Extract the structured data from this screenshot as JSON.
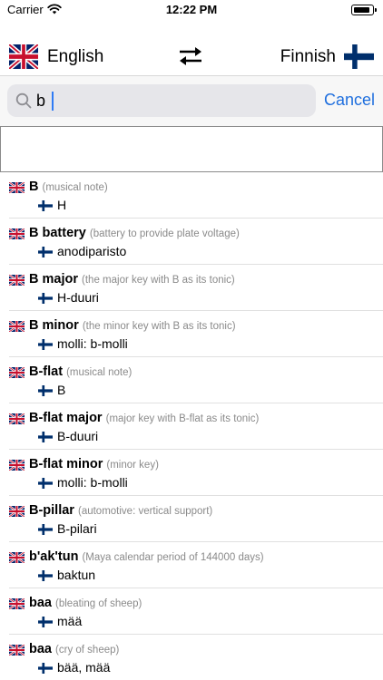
{
  "status_bar": {
    "carrier": "Carrier",
    "time": "12:22 PM"
  },
  "languages": {
    "source": "English",
    "target": "Finnish",
    "source_flag": "uk-flag-icon",
    "target_flag": "finland-flag-icon"
  },
  "search": {
    "value": "b",
    "cancel_label": "Cancel"
  },
  "colors": {
    "accent": "#1f6fde",
    "note": "#8a8a8a",
    "flag_uk_blue": "#012169",
    "flag_uk_red": "#C8102E",
    "flag_fi_blue": "#002F6C"
  },
  "entries": [
    {
      "term": "B",
      "note": "(musical note)",
      "translation": "H"
    },
    {
      "term": "B battery",
      "note": "(battery to provide plate voltage)",
      "translation": "anodiparisto"
    },
    {
      "term": "B major",
      "note": "(the major key with B as its tonic)",
      "translation": "H-duuri"
    },
    {
      "term": "B minor",
      "note": "(the minor key with B as its tonic)",
      "translation": "molli: b-molli"
    },
    {
      "term": "B-flat",
      "note": "(musical note)",
      "translation": "B"
    },
    {
      "term": "B-flat major",
      "note": "(major key with B-flat as its tonic)",
      "translation": "B-duuri"
    },
    {
      "term": "B-flat minor",
      "note": "(minor key)",
      "translation": "molli: b-molli"
    },
    {
      "term": "B-pillar",
      "note": "(automotive: vertical support)",
      "translation": "B-pilari"
    },
    {
      "term": "b'ak'tun",
      "note": "(Maya calendar period of 144000 days)",
      "translation": "baktun"
    },
    {
      "term": "baa",
      "note": "(bleating of sheep)",
      "translation": "mää"
    },
    {
      "term": "baa",
      "note": "(cry of sheep)",
      "translation": "bää, mää"
    }
  ]
}
